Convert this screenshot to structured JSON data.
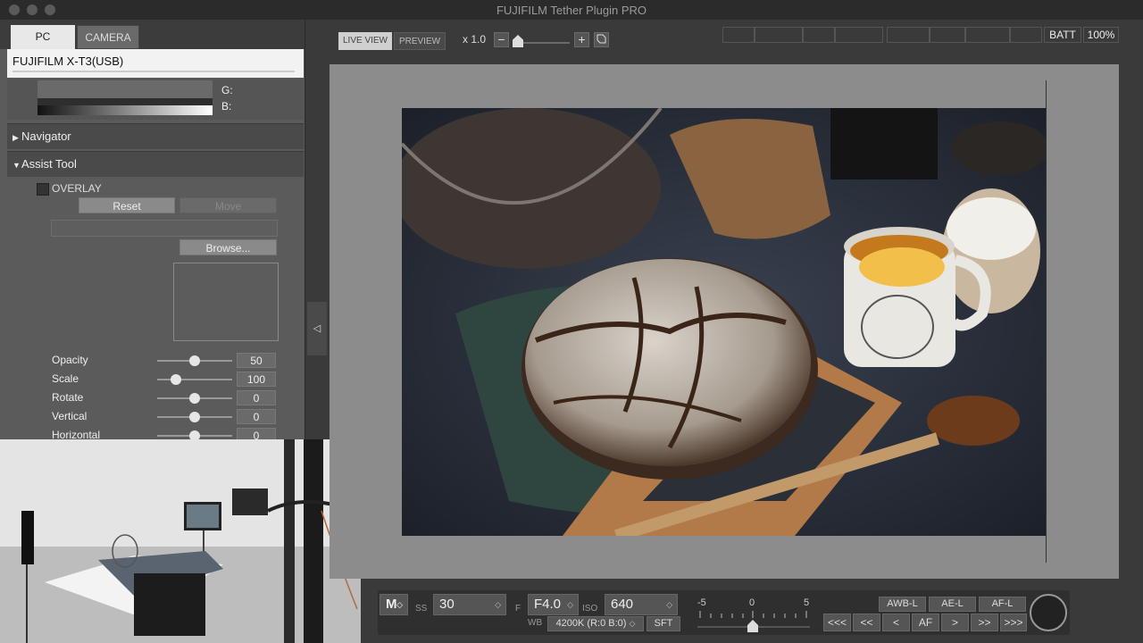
{
  "window": {
    "title": "FUJIFILM Tether Plugin PRO"
  },
  "tabs": [
    {
      "label": "PC"
    },
    {
      "label": "CAMERA"
    }
  ],
  "camera": {
    "name": "FUJIFILM X-T3(USB)"
  },
  "histogram": {
    "g_label": "G:",
    "b_label": "B:"
  },
  "sections": {
    "navigator": "Navigator",
    "assist": "Assist Tool"
  },
  "assist": {
    "overlay_label": "OVERLAY",
    "reset_label": "Reset",
    "move_label": "Move",
    "browse_label": "Browse...",
    "rows": [
      {
        "label": "Opacity",
        "value": "50"
      },
      {
        "label": "Scale",
        "value": "100"
      },
      {
        "label": "Rotate",
        "value": "0"
      },
      {
        "label": "Vertical",
        "value": "0"
      },
      {
        "label": "Horizontal",
        "value": "0"
      }
    ]
  },
  "toolbar": {
    "live_view": "LIVE VIEW",
    "preview": "PREVIEW",
    "zoom": "x 1.0",
    "batt_label": "BATT",
    "batt_value": "100%"
  },
  "exposure": {
    "mode": "M",
    "ss_label": "SS",
    "ss_value": "30",
    "f_label": "F",
    "f_value": "F4.0",
    "iso_label": "ISO",
    "iso_value": "640",
    "wb_label": "WB",
    "wb_value": "4200K (R:0 B:0)",
    "sft_label": "SFT",
    "scale_min": "-5",
    "scale_mid": "0",
    "scale_max": "5",
    "awb_lock": "AWB-L",
    "ae_lock": "AE-L",
    "af_lock": "AF-L",
    "nav": [
      "<<<",
      "<<",
      "<",
      "AF",
      ">",
      ">>",
      ">>>"
    ]
  },
  "colors": {
    "panel": "#5b5b5b",
    "canvas": "#8c8c8c",
    "background": "#3a3a3a"
  },
  "icons": [
    "minus-icon",
    "plus-icon",
    "fit-icon",
    "collapse-arrow-icon",
    "shutter-icon"
  ]
}
